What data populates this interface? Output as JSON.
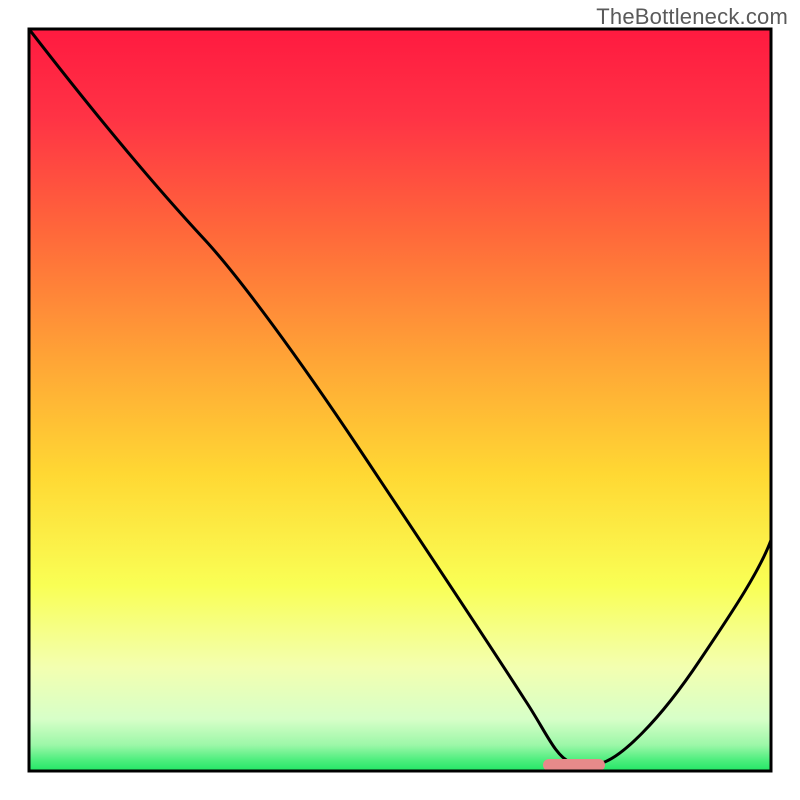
{
  "watermark": "TheBottleneck.com",
  "chart_data": {
    "type": "line",
    "title": "",
    "xlabel": "",
    "ylabel": "",
    "xlim": [
      0,
      100
    ],
    "ylim": [
      0,
      100
    ],
    "note": "No axis ticks or numeric labels are rendered in the image; values below are normalized estimates (0–100) read from the visual geometry of the curve relative to the plot frame.",
    "series": [
      {
        "name": "bottleneck-curve",
        "x": [
          0,
          10,
          20,
          30,
          40,
          50,
          60,
          67,
          70,
          74,
          80,
          90,
          100
        ],
        "y": [
          100,
          88,
          78,
          63,
          48,
          33,
          18,
          4,
          1,
          1,
          6,
          20,
          34
        ]
      }
    ],
    "marker": {
      "name": "optimal-range",
      "x_start": 67,
      "x_end": 75,
      "y": 0.7,
      "color": "#e68a8a"
    },
    "background_gradient": {
      "type": "vertical",
      "stops": [
        {
          "y": 100,
          "color": "#ff1a40"
        },
        {
          "y": 75,
          "color": "#ff6a3a"
        },
        {
          "y": 50,
          "color": "#ffcc33"
        },
        {
          "y": 25,
          "color": "#f6ff5a"
        },
        {
          "y": 6,
          "color": "#eaffd0"
        },
        {
          "y": 0,
          "color": "#2ee86b"
        }
      ]
    },
    "frame_color": "#000000"
  }
}
